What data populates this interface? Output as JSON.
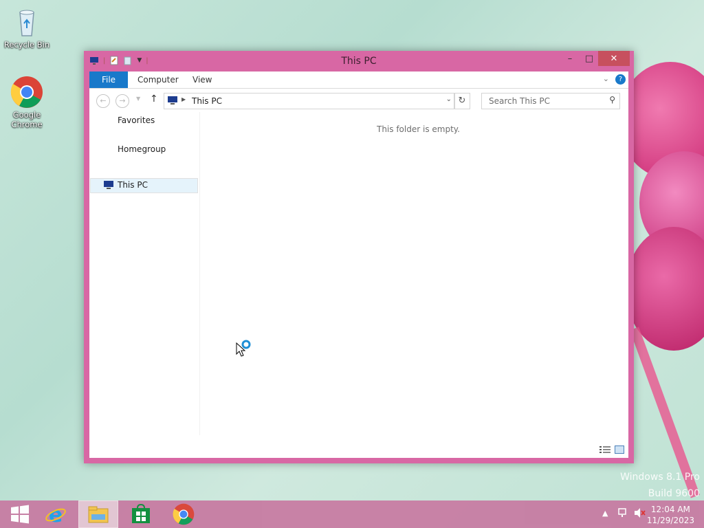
{
  "desktop": {
    "icons": [
      {
        "label": "Recycle Bin",
        "icon": "recycle-bin-icon"
      },
      {
        "label": "Google Chrome",
        "icon": "chrome-icon"
      }
    ],
    "watermark_line1": "Windows 8.1 Pro",
    "watermark_line2": "Build 9600"
  },
  "window": {
    "title": "This PC",
    "controls": {
      "minimize": "–",
      "maximize": "□",
      "close": "✕"
    },
    "ribbon_tabs": [
      "File",
      "Computer",
      "View"
    ],
    "address": {
      "path": "This PC"
    },
    "search": {
      "placeholder": "Search This PC"
    },
    "nav_pane": {
      "items": [
        "Favorites",
        "Homegroup",
        "This PC"
      ],
      "selected": "This PC"
    },
    "empty_message": "This folder is empty."
  },
  "taskbar": {
    "apps": [
      "start-icon",
      "internet-explorer-icon",
      "file-explorer-icon",
      "store-icon",
      "chrome-icon"
    ],
    "active_app": "file-explorer-icon",
    "clock_time": "12:04 AM",
    "clock_date": "11/29/2023"
  },
  "colors": {
    "window_frame": "#d867a4",
    "file_tab": "#1979ca",
    "close_button": "#c7505e",
    "taskbar": "#c77ea4"
  }
}
